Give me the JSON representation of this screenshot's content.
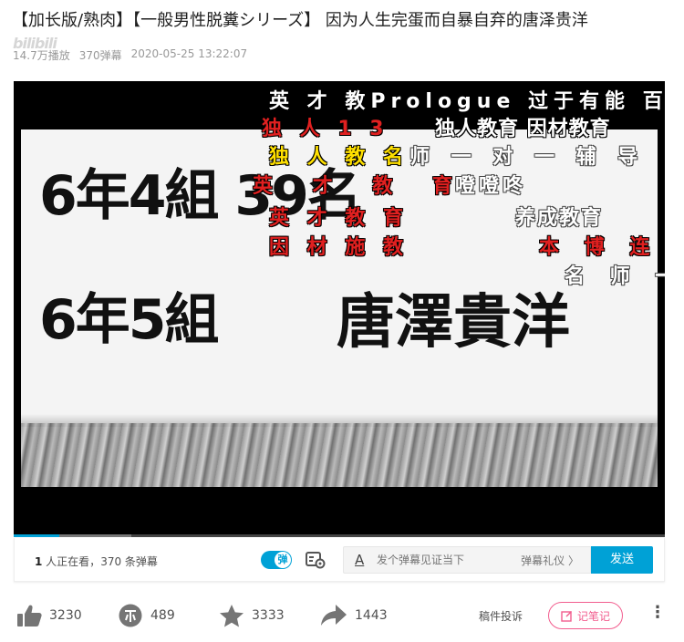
{
  "video": {
    "title": "【加长版/熟肉】【一般男性脱糞シリーズ】 因为人生完蛋而自暴自弃的唐泽贵洋",
    "views": "14.7万播放",
    "danmaku_count": "370弹幕",
    "date": "2020-05-25 13:22:07",
    "watermark": "bilibili"
  },
  "frame": {
    "line1": "6年4組  39名",
    "line2": "6年5組",
    "line2_name": "唐澤貴洋"
  },
  "danmaku": [
    {
      "text": "英 才 教Prologue   过于有能   百",
      "color": "white"
    },
    {
      "text": "独  人  1  3",
      "color": "red"
    },
    {
      "text": "独人教育 因材教育",
      "color": "white"
    },
    {
      "text": "独 人 教 名",
      "color": "yellow"
    },
    {
      "text": "师 一 对 一 辅 导",
      "color": "white"
    },
    {
      "text": "英 才 教 育",
      "color": "red"
    },
    {
      "text": "噔噔咚",
      "color": "white"
    },
    {
      "text": "英 才 教 育",
      "color": "red"
    },
    {
      "text": "养成教育",
      "color": "white"
    },
    {
      "text": "因 材 施 教",
      "color": "red"
    },
    {
      "text": "本 博 连 论",
      "color": "red"
    },
    {
      "text": "名 师 一",
      "color": "white"
    }
  ],
  "progress": {
    "played_fraction": 0.07,
    "buffered_fraction": 0.18
  },
  "danmaku_bar": {
    "viewers_count": "1",
    "viewers_text": " 人正在看，",
    "danmaku_total": "370 条弹幕",
    "toggle_label": "弹",
    "input_placeholder": "发个弹幕见证当下",
    "etiquette": "弹幕礼仪 〉",
    "send_label": "发送"
  },
  "toolbar": {
    "like": "3230",
    "coin": "489",
    "favorite": "3333",
    "share": "1443",
    "report": "稿件投诉",
    "note": "记笔记",
    "more": "⋮"
  },
  "colors": {
    "accent": "#00a1d6",
    "pink": "#f25d8e",
    "danmaku_red": "#e02020",
    "danmaku_yellow": "#ffe000"
  }
}
